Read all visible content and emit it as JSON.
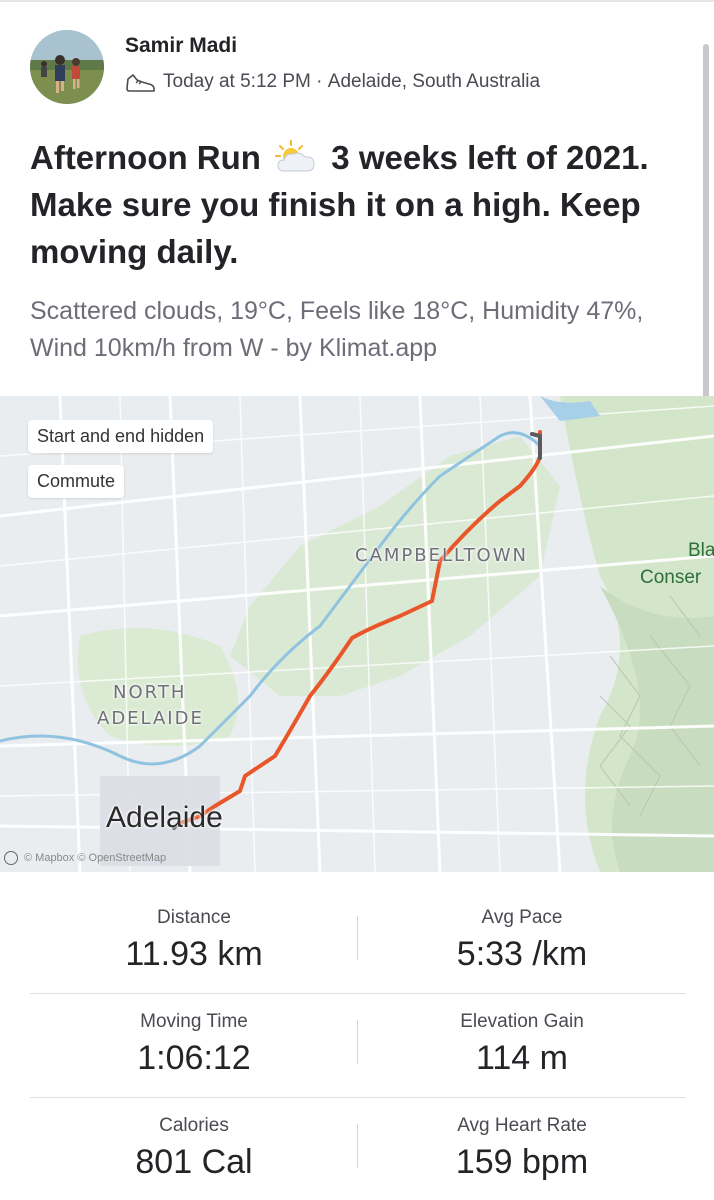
{
  "activity": {
    "athlete_name": "Samir Madi",
    "timestamp": "Today at 5:12 PM",
    "location_separator": " · ",
    "location": "Adelaide, South Australia",
    "sport_icon": "running-shoe-icon",
    "title_before_icon": "Afternoon Run",
    "weather_icon": "sun-behind-cloud-icon",
    "title_after_icon": "3 weeks left of 2021. Make sure you finish it on a high. Keep moving daily.",
    "description": "Scattered clouds, 19°C, Feels like 18°C, Humidity 47%, Wind 10km/h from W - by Klimat.app"
  },
  "map": {
    "badges": [
      "Start and end hidden",
      "Commute"
    ],
    "labels": {
      "suburb_1": "CAMPBELLTOWN",
      "suburb_2_line1": "NORTH",
      "suburb_2_line2": "ADELAIDE",
      "city": "Adelaide",
      "park_line1": "Bla",
      "park_line2": "Conser"
    },
    "attribution": "© Mapbox © OpenStreetMap",
    "route_color": "#e8562a"
  },
  "stats": [
    [
      {
        "label": "Distance",
        "value": "11.93 km"
      },
      {
        "label": "Avg Pace",
        "value": "5:33 /km"
      }
    ],
    [
      {
        "label": "Moving Time",
        "value": "1:06:12"
      },
      {
        "label": "Elevation Gain",
        "value": "114 m"
      }
    ],
    [
      {
        "label": "Calories",
        "value": "801 Cal"
      },
      {
        "label": "Avg Heart Rate",
        "value": "159 bpm"
      }
    ]
  ]
}
